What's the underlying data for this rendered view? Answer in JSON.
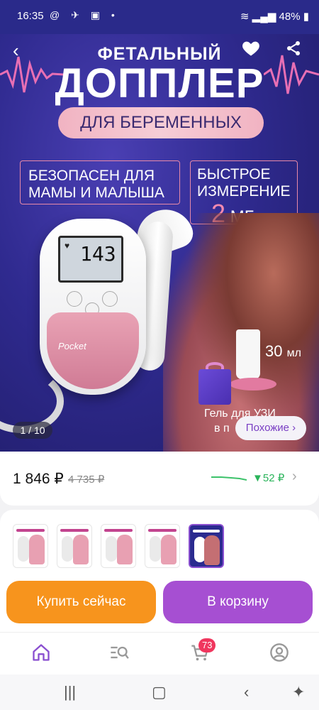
{
  "status_bar": {
    "time": "16:35",
    "battery": "48%"
  },
  "hero": {
    "title_line1": "ФЕТАЛЬНЫЙ",
    "title_line2": "ДОППЛЕР",
    "subtitle": "ДЛЯ БЕРЕМЕННЫХ",
    "feature1_line1": "БЕЗОПАСЕН ДЛЯ",
    "feature1_line2": "МАМЫ И МАЛЫША",
    "feature2_line1": "БЫСТРОЕ",
    "feature2_line2": "ИЗМЕРЕНИЕ",
    "freq_value": "2",
    "freq_unit": "МГц",
    "device_reading": "143",
    "device_brand": "Pocket",
    "gel_volume": "30",
    "gel_unit": "мл",
    "gel_line1": "Гель для УЗИ",
    "gel_line2": "в п",
    "image_counter": "1 / 10",
    "similar_label": "Похожие ›"
  },
  "price": {
    "current": "1 846 ₽",
    "old": "4 735 ₽",
    "trend_value": "▼52 ₽"
  },
  "thumbnails": [
    {
      "label": "ФЕТАЛЬНЫЙ ДОППЛЕР",
      "selected": false
    },
    {
      "label": "ФЕТАЛЬНЫЙ ДОППЛЕР",
      "selected": false
    },
    {
      "label": "ФЕТАЛЬНЫЙ ДОППЛЕР",
      "selected": false
    },
    {
      "label": "ФЕТАЛЬНЫЙ ДОППЛЕР",
      "selected": false
    },
    {
      "label": "ДОППЛЕР",
      "selected": true
    }
  ],
  "actions": {
    "buy_now": "Купить сейчас",
    "add_to_cart": "В корзину"
  },
  "tabbar": {
    "cart_badge": "73",
    "icons": [
      "home-icon",
      "catalog-search-icon",
      "cart-icon",
      "profile-icon"
    ]
  },
  "colors": {
    "buy_button": "#f7941d",
    "cart_button": "#a64fd2",
    "accent_purple": "#7a3fc4",
    "price_drop_green": "#2bb45b",
    "badge_red": "#f0365e"
  }
}
